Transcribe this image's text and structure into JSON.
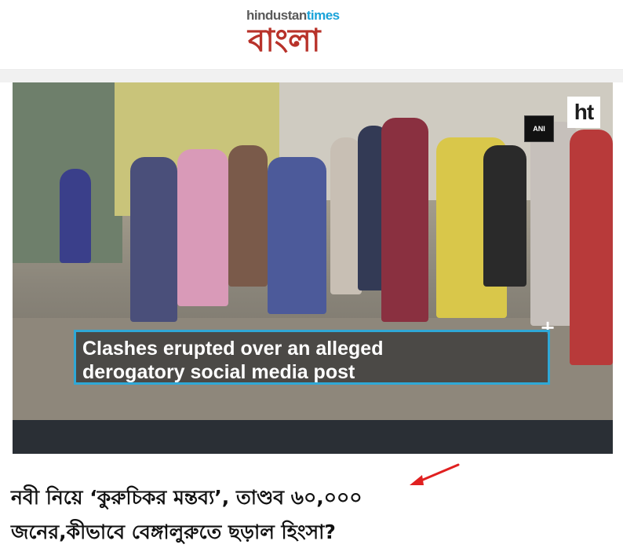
{
  "header": {
    "logo_top_left": "hindustan",
    "logo_top_right": "times",
    "logo_bottom": "বাংলা"
  },
  "video": {
    "badge_ht": "ht",
    "badge_ani": "ANI",
    "caption_line1": "Clashes erupted over an alleged",
    "caption_line2": "derogatory social media post",
    "accent_color": "#2fa8d6"
  },
  "article": {
    "headline_line1": "নবী নিয়ে ‘কুরুচিকর মন্তব্য’, তাণ্ডব ৬০,০০০",
    "headline_line2": "জনের,কীভাবে বেঙ্গালুরুতে ছড়াল হিংসা?"
  },
  "annotation": {
    "arrow_color": "#e02020"
  }
}
